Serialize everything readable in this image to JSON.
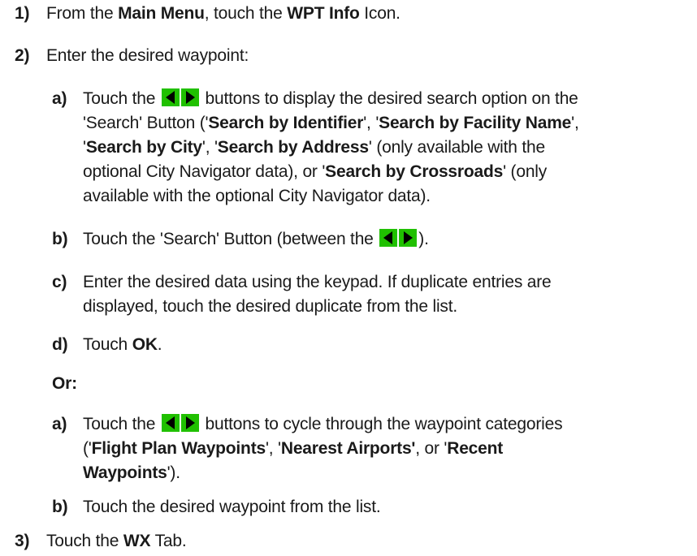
{
  "steps": {
    "s1": {
      "num": "1)",
      "t1": "From the ",
      "b1": "Main Menu",
      "t2": ", touch the ",
      "b2": "WPT Info",
      "t3": " Icon."
    },
    "s2": {
      "num": "2)",
      "t1": "Enter the desired waypoint:"
    },
    "s2a": {
      "num": "a)",
      "l1_pre": "Touch the ",
      "l1_post": " buttons to display the desired search option on the",
      "l2_pre": "'Search' Button ('",
      "l2_b1": "Search by Identifier",
      "l2_mid": "', '",
      "l2_b2": "Search by Facility Name",
      "l2_end": "',",
      "l3_pre": "'",
      "l3_b1": "Search by City",
      "l3_mid": "',  '",
      "l3_b2": "Search by Address",
      "l3_end": "' (only available with the",
      "l4_pre": "optional City Navigator data), or '",
      "l4_b1": "Search by Crossroads",
      "l4_end": "' (only",
      "l5": "available with the optional City Navigator data)."
    },
    "s2b": {
      "num": "b)",
      "pre": "Touch the 'Search' Button (between the ",
      "post": ")."
    },
    "s2c": {
      "num": "c)",
      "l1": "Enter the desired data using the keypad.  If duplicate entries are",
      "l2": "displayed, touch the desired duplicate from the list."
    },
    "s2d": {
      "num": "d)",
      "pre": "Touch ",
      "b1": "OK",
      "post": "."
    },
    "or": "Or:",
    "s2a2": {
      "num": "a)",
      "l1_pre": "Touch the ",
      "l1_post": " buttons to cycle through the waypoint categories",
      "l2_pre": "('",
      "l2_b1": "Flight Plan Waypoints",
      "l2_mid": "', '",
      "l2_b2": "Nearest Airports'",
      "l2_mid2": ", or '",
      "l2_b3": "Recent",
      "l3_b1": "Waypoints",
      "l3_end": "')."
    },
    "s2b2": {
      "num": "b)",
      "t1": "Touch the desired waypoint from the list."
    },
    "s3": {
      "num": "3)",
      "t1": "Touch the ",
      "b1": "WX",
      "t2": " Tab."
    }
  },
  "colors": {
    "arrow_bg": "#20c000",
    "arrow_fg": "#000000"
  },
  "icons": {
    "arrow_button": "left-right-arrow-buttons-icon"
  }
}
